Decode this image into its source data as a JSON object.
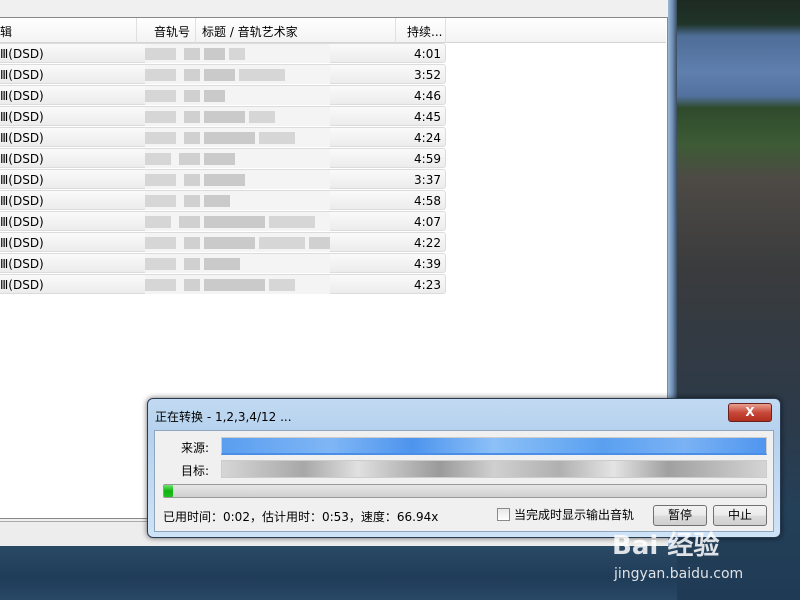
{
  "list": {
    "headers": {
      "album": "辑",
      "track_no": "音轨号",
      "title_artist": "标题 / 音轨艺术家",
      "duration": "持续..."
    },
    "rows": [
      {
        "album": "Ⅲ(DSD)",
        "duration": "4:01"
      },
      {
        "album": "Ⅲ(DSD)",
        "duration": "3:52"
      },
      {
        "album": "Ⅲ(DSD)",
        "duration": "4:46"
      },
      {
        "album": "Ⅲ(DSD)",
        "duration": "4:45"
      },
      {
        "album": "Ⅲ(DSD)",
        "duration": "4:24"
      },
      {
        "album": "Ⅲ(DSD)",
        "duration": "4:59"
      },
      {
        "album": "Ⅲ(DSD)",
        "duration": "3:37"
      },
      {
        "album": "Ⅲ(DSD)",
        "duration": "4:58"
      },
      {
        "album": "Ⅲ(DSD)",
        "duration": "4:07"
      },
      {
        "album": "Ⅲ(DSD)",
        "duration": "4:22"
      },
      {
        "album": "Ⅲ(DSD)",
        "duration": "4:39"
      },
      {
        "album": "Ⅲ(DSD)",
        "duration": "4:23"
      }
    ]
  },
  "dialog": {
    "title": "正在转换 - 1,2,3,4/12 ...",
    "close_label": "X",
    "source_label": "来源:",
    "target_label": "目标:",
    "progress_percent": 1.5,
    "status": "已用时间：0:02，估计用时：0:53，速度：66.94x",
    "checkbox_label": "当完成时显示输出音轨",
    "checkbox_checked": false,
    "pause_label": "暂停",
    "stop_label": "中止"
  },
  "watermark": {
    "brand": "Bai 经验",
    "url": "jingyan.baidu.com"
  }
}
